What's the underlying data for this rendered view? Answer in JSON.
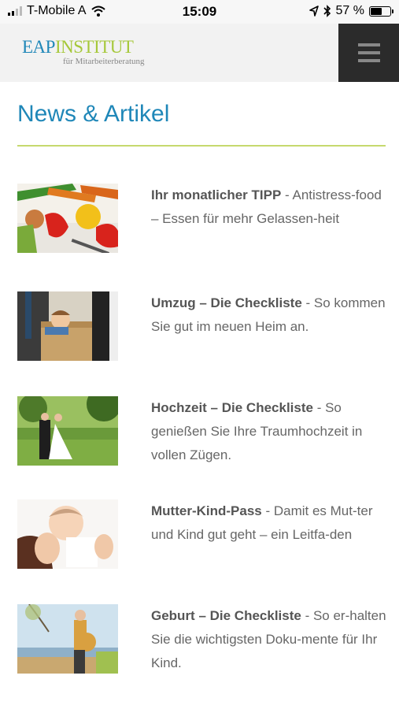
{
  "status_bar": {
    "carrier": "T-Mobile A",
    "time": "15:09",
    "battery": "57 %",
    "battery_level": 0.57,
    "icons": [
      "signal-icon",
      "wifi-icon",
      "location-icon",
      "bluetooth-icon",
      "battery-icon"
    ]
  },
  "header": {
    "logo_part1": "EAP",
    "logo_part2": "INSTITUT",
    "logo_sub": "für Mitarbeiterberatung",
    "menu_icon": "hamburger-menu-icon"
  },
  "page": {
    "title": "News & Artikel"
  },
  "articles": [
    {
      "title": "Ihr monatlicher TIPP",
      "teaser": " - Antistress-food – Essen für mehr Gelassen-heit",
      "image": "vegetables"
    },
    {
      "title": "Umzug – Die Checkliste",
      "teaser": " - So kommen Sie gut im neuen Heim an.",
      "image": "child-in-moving-box"
    },
    {
      "title": "Hochzeit – Die Checkliste",
      "teaser": " - So genießen Sie Ihre Traumhochzeit in vollen Zügen.",
      "image": "wedding-couple"
    },
    {
      "title": "Mutter-Kind-Pass",
      "teaser": " - Damit es Mut-ter und Kind gut geht – ein Leitfa-den",
      "image": "mother-and-baby"
    },
    {
      "title": "Geburt – Die Checkliste",
      "teaser": " - So er-halten Sie die wichtigsten Doku-mente für Ihr Kind.",
      "image": "pregnant-woman"
    }
  ],
  "colors": {
    "brand_blue": "#1f87b8",
    "brand_green": "#a6c83a",
    "rule_green": "#c6d96e",
    "menu_bg": "#2b2b2b"
  }
}
